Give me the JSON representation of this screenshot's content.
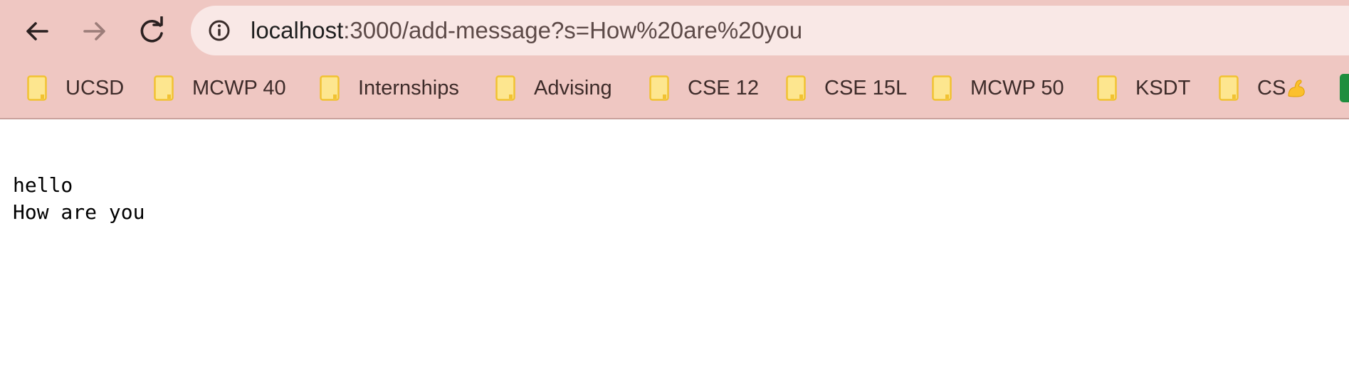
{
  "browser": {
    "url": {
      "host": "localhost",
      "rest": ":3000/add-message?s=How%20are%20you"
    },
    "bookmarks": [
      {
        "label": "UCSD"
      },
      {
        "label": "MCWP 40"
      },
      {
        "label": "Internships"
      },
      {
        "label": "Advising"
      },
      {
        "label": "CSE 12"
      },
      {
        "label": "CSE 15L"
      },
      {
        "label": "MCWP 50"
      },
      {
        "label": "KSDT"
      },
      {
        "label": "CS",
        "emoji": "flexed-biceps-emoji"
      }
    ],
    "icons": {
      "back": "back-arrow-icon",
      "forward": "forward-arrow-icon",
      "reload": "reload-icon",
      "site_info": "info-icon",
      "bookmark": "folder-icon"
    },
    "colors": {
      "toolbar": "#efc7c2",
      "omnibox": "#f9e8e6",
      "folder_fill": "#fde68f",
      "folder_stroke": "#f1c232"
    }
  },
  "page": {
    "lines": [
      "hello",
      "How are you"
    ]
  }
}
